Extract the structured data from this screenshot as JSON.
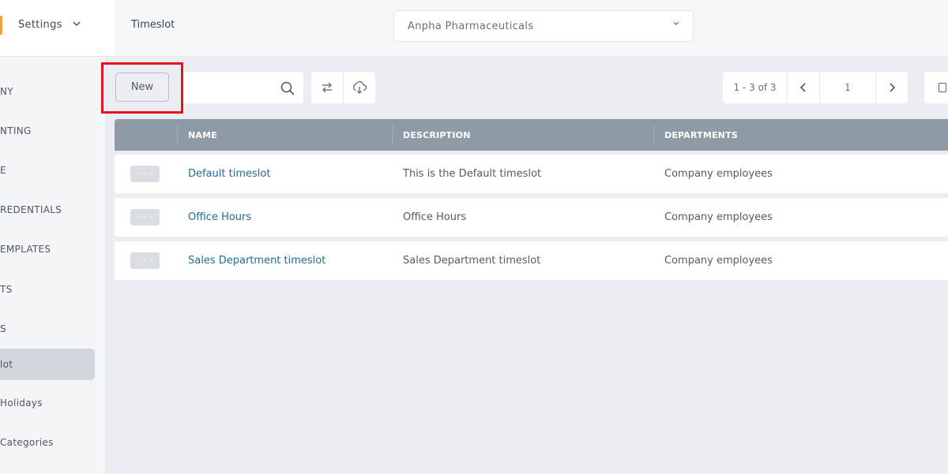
{
  "sidebar": {
    "title": "Settings",
    "items": [
      {
        "label": "NY"
      },
      {
        "label": "NTING"
      },
      {
        "label": "E"
      },
      {
        "label": "REDENTIALS"
      },
      {
        "label": "EMPLATES"
      },
      {
        "label": "TS"
      },
      {
        "label": "S"
      },
      {
        "label": "lot"
      },
      {
        "label": " Holidays"
      },
      {
        "label": "Categories"
      }
    ]
  },
  "header": {
    "title": "Timeslot",
    "company_select": {
      "value": "Anpha Pharmaceuticals",
      "icon": "chevron-down-icon"
    }
  },
  "toolbar": {
    "new_label": "New",
    "search_placeholder": "",
    "icons": [
      "search-icon",
      "refresh-icon",
      "cloud-download-icon"
    ]
  },
  "pager": {
    "count": "1 - 3 of 3",
    "page": "1"
  },
  "table": {
    "columns": [
      "NAME",
      "DESCRIPTION",
      "DEPARTMENTS"
    ],
    "rows": [
      {
        "menu": "- - -",
        "name": "Default timeslot",
        "description": "This is the Default timeslot",
        "departments": "Company employees"
      },
      {
        "menu": "- - -",
        "name": "Office Hours",
        "description": "Office Hours",
        "departments": "Company employees"
      },
      {
        "menu": "- - -",
        "name": "Sales Department timeslot",
        "description": "Sales Department timeslot",
        "departments": "Company employees"
      }
    ]
  },
  "colors": {
    "accent": "#f0a040",
    "link": "#256a8e",
    "table_header": "#8e9aa6",
    "highlight": "#e3141d"
  }
}
